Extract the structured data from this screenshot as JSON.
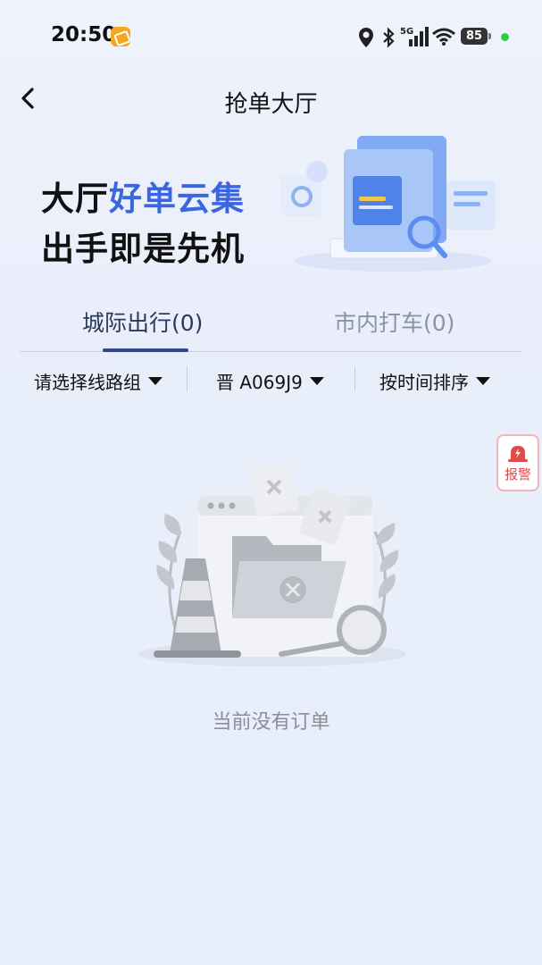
{
  "status_bar": {
    "time": "20:50",
    "network": "5G",
    "battery": "85",
    "icons": [
      "location-icon",
      "bluetooth-icon",
      "signal-icon",
      "wifi-icon",
      "battery-icon"
    ]
  },
  "nav": {
    "title": "抢单大厅",
    "back_icon": "chevron-left-icon"
  },
  "banner": {
    "line1_prefix": "大厅",
    "line1_accent": "好单云集",
    "line2": "出手即是先机",
    "accent_color": "#3a66e0"
  },
  "tabs": [
    {
      "label": "城际出行(0)",
      "active": true
    },
    {
      "label": "市内打车(0)",
      "active": false
    }
  ],
  "filters": {
    "route_group": "请选择线路组",
    "plate": "晋 A069J9",
    "sort": "按时间排序"
  },
  "alarm": {
    "label": "报警",
    "color": "#e04a4a"
  },
  "empty_state": {
    "message": "当前没有订单"
  }
}
